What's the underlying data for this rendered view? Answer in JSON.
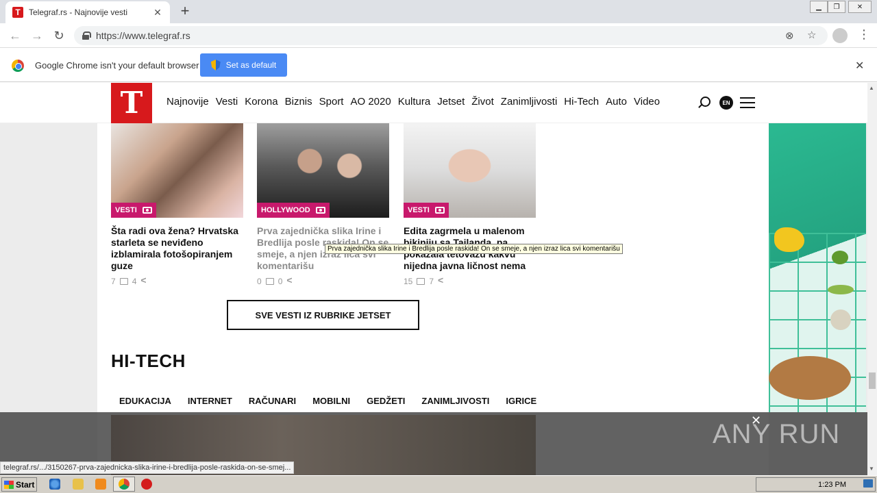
{
  "browser": {
    "tab_title": "Telegraf.rs - Najnovije vesti",
    "tab_favicon": "T",
    "new_tab": "+",
    "close": "✕",
    "url": "https://www.telegraf.rs",
    "infobar_text": "Google Chrome isn't your default browser",
    "set_default": "Set as default",
    "status_url": "telegraf.rs/.../3150267-prva-zajednicka-slika-irine-i-bredlija-posle-raskida-on-se-smej..."
  },
  "site": {
    "logo": "T",
    "nav": [
      "Najnovije",
      "Vesti",
      "Korona",
      "Biznis",
      "Sport",
      "AO 2020",
      "Kultura",
      "Jetset",
      "Život",
      "Zanimljivosti",
      "Hi-Tech",
      "Auto",
      "Video"
    ],
    "lang": "EN"
  },
  "cards": [
    {
      "category": "VESTI",
      "title": "Šta radi ova žena? Hrvatska starleta se neviđeno izblamirala fotošopiranjem guze",
      "comments": "7",
      "shares": "4"
    },
    {
      "category": "HOLLYWOOD",
      "title": "Prva zajednička slika Irine i Bredlija posle raskida! On se smeje, a njen izraz lica svi komentarišu",
      "comments": "0",
      "shares": "0"
    },
    {
      "category": "VESTI",
      "title": "Edita zagrmela u malenom bikiniju sa Tajlanda, pa pokazala tetovažu kakvu nijedna javna ličnost nema",
      "comments": "15",
      "shares": "7"
    }
  ],
  "tooltip": "Prva zajednička slika Irine i Bredlija posle raskida! On se smeje, a njen izraz lica svi komentarišu",
  "more_button": "SVE VESTI IZ RUBRIKE JETSET",
  "section": {
    "title": "HI-TECH",
    "subnav": [
      "EDUKACIJA",
      "INTERNET",
      "RAČUNARI",
      "MOBILNI",
      "GEDŽETI",
      "ZANIMLJIVOSTI",
      "IGRICE"
    ]
  },
  "watermark": "ANY RUN",
  "taskbar": {
    "start": "Start",
    "time": "1:23 PM"
  },
  "icons": [
    "back-icon",
    "forward-icon",
    "reload-icon",
    "lock-icon",
    "star-icon",
    "search-icon",
    "menu-icon"
  ]
}
